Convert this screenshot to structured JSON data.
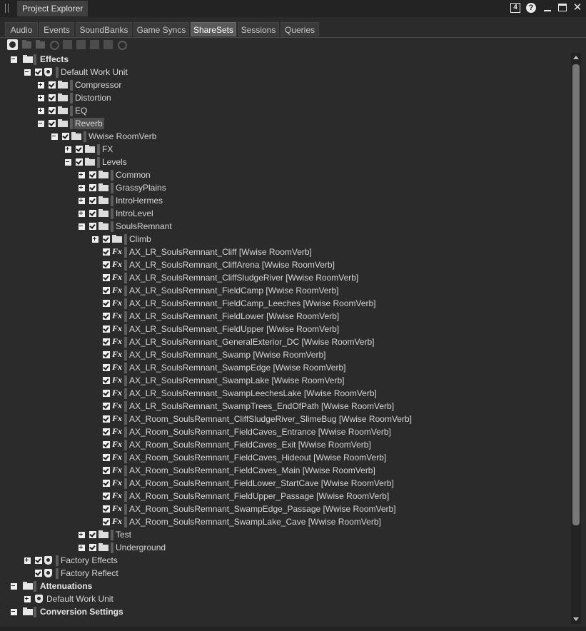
{
  "titlebar": {
    "title": "Project Explorer",
    "badge": "4",
    "help_glyph": "?",
    "close_glyph": "✕"
  },
  "tabs": [
    {
      "label": "Audio",
      "active": false
    },
    {
      "label": "Events",
      "active": false
    },
    {
      "label": "SoundBanks",
      "active": false
    },
    {
      "label": "Game Syncs",
      "active": false
    },
    {
      "label": "ShareSets",
      "active": true
    },
    {
      "label": "Sessions",
      "active": false
    },
    {
      "label": "Queries",
      "active": false
    }
  ],
  "toolbar": {
    "icons": [
      "workunit-filter-icon",
      "folder-filter-icon",
      "folder-open-filter-icon",
      "effect-filter-icon",
      "switch-filter-icon",
      "waveform-filter-icon",
      "curve-filter-icon",
      "meter-filter-icon",
      "clock-filter-icon"
    ]
  },
  "tree": [
    {
      "label": "Effects",
      "level": 0,
      "icon": "folder",
      "expander": "minus",
      "check": false,
      "bold": true
    },
    {
      "label": "Default Work Unit",
      "level": 1,
      "icon": "workunit",
      "expander": "minus",
      "check": true
    },
    {
      "label": "Compressor",
      "level": 2,
      "icon": "folder",
      "expander": "plus",
      "check": true
    },
    {
      "label": "Distortion",
      "level": 2,
      "icon": "folder",
      "expander": "plus",
      "check": true
    },
    {
      "label": "EQ",
      "level": 2,
      "icon": "folder",
      "expander": "plus",
      "check": true
    },
    {
      "label": "Reverb",
      "level": 2,
      "icon": "folder",
      "expander": "minus",
      "check": true,
      "selected": true
    },
    {
      "label": "Wwise RoomVerb",
      "level": 3,
      "icon": "folder",
      "expander": "minus",
      "check": true
    },
    {
      "label": "FX",
      "level": 4,
      "icon": "folder",
      "expander": "plus",
      "check": true
    },
    {
      "label": "Levels",
      "level": 4,
      "icon": "folder",
      "expander": "minus",
      "check": true
    },
    {
      "label": "Common",
      "level": 5,
      "icon": "folder",
      "expander": "plus",
      "check": true
    },
    {
      "label": "GrassyPlains",
      "level": 5,
      "icon": "folder",
      "expander": "plus",
      "check": true
    },
    {
      "label": "IntroHermes",
      "level": 5,
      "icon": "folder",
      "expander": "plus",
      "check": true
    },
    {
      "label": "IntroLevel",
      "level": 5,
      "icon": "folder",
      "expander": "plus",
      "check": true
    },
    {
      "label": "SoulsRemnant",
      "level": 5,
      "icon": "folder",
      "expander": "minus",
      "check": true
    },
    {
      "label": "Climb",
      "level": 6,
      "icon": "folder",
      "expander": "plus",
      "check": true
    },
    {
      "label": "AX_LR_SoulsRemnant_Cliff [Wwise RoomVerb]",
      "level": 6,
      "icon": "fx",
      "check": true
    },
    {
      "label": "AX_LR_SoulsRemnant_CliffArena [Wwise RoomVerb]",
      "level": 6,
      "icon": "fx",
      "check": true
    },
    {
      "label": "AX_LR_SoulsRemnant_CliffSludgeRiver [Wwise RoomVerb]",
      "level": 6,
      "icon": "fx",
      "check": true
    },
    {
      "label": "AX_LR_SoulsRemnant_FieldCamp [Wwise RoomVerb]",
      "level": 6,
      "icon": "fx",
      "check": true
    },
    {
      "label": "AX_LR_SoulsRemnant_FieldCamp_Leeches [Wwise RoomVerb]",
      "level": 6,
      "icon": "fx",
      "check": true
    },
    {
      "label": "AX_LR_SoulsRemnant_FieldLower [Wwise RoomVerb]",
      "level": 6,
      "icon": "fx",
      "check": true
    },
    {
      "label": "AX_LR_SoulsRemnant_FieldUpper [Wwise RoomVerb]",
      "level": 6,
      "icon": "fx",
      "check": true
    },
    {
      "label": "AX_LR_SoulsRemnant_GeneralExterior_DC [Wwise RoomVerb]",
      "level": 6,
      "icon": "fx",
      "check": true
    },
    {
      "label": "AX_LR_SoulsRemnant_Swamp [Wwise RoomVerb]",
      "level": 6,
      "icon": "fx",
      "check": true
    },
    {
      "label": "AX_LR_SoulsRemnant_SwampEdge [Wwise RoomVerb]",
      "level": 6,
      "icon": "fx",
      "check": true
    },
    {
      "label": "AX_LR_SoulsRemnant_SwampLake [Wwise RoomVerb]",
      "level": 6,
      "icon": "fx",
      "check": true
    },
    {
      "label": "AX_LR_SoulsRemnant_SwampLeechesLake [Wwise RoomVerb]",
      "level": 6,
      "icon": "fx",
      "check": true
    },
    {
      "label": "AX_LR_SoulsRemnant_SwampTrees_EndOfPath [Wwise RoomVerb]",
      "level": 6,
      "icon": "fx",
      "check": true
    },
    {
      "label": "AX_Room_SoulsRemnant_CliffSludgeRiver_SlimeBug [Wwise RoomVerb]",
      "level": 6,
      "icon": "fx",
      "check": true
    },
    {
      "label": "AX_Room_SoulsRemnant_FieldCaves_Entrance [Wwise RoomVerb]",
      "level": 6,
      "icon": "fx",
      "check": true
    },
    {
      "label": "AX_Room_SoulsRemnant_FieldCaves_Exit [Wwise RoomVerb]",
      "level": 6,
      "icon": "fx",
      "check": true
    },
    {
      "label": "AX_Room_SoulsRemnant_FieldCaves_Hideout [Wwise RoomVerb]",
      "level": 6,
      "icon": "fx",
      "check": true
    },
    {
      "label": "AX_Room_SoulsRemnant_FieldCaves_Main [Wwise RoomVerb]",
      "level": 6,
      "icon": "fx",
      "check": true
    },
    {
      "label": "AX_Room_SoulsRemnant_FieldLower_StartCave [Wwise RoomVerb]",
      "level": 6,
      "icon": "fx",
      "check": true
    },
    {
      "label": "AX_Room_SoulsRemnant_FieldUpper_Passage [Wwise RoomVerb]",
      "level": 6,
      "icon": "fx",
      "check": true
    },
    {
      "label": "AX_Room_SoulsRemnant_SwampEdge_Passage [Wwise RoomVerb]",
      "level": 6,
      "icon": "fx",
      "check": true
    },
    {
      "label": "AX_Room_SoulsRemnant_SwampLake_Cave [Wwise RoomVerb]",
      "level": 6,
      "icon": "fx",
      "check": true
    },
    {
      "label": "Test",
      "level": 5,
      "icon": "folder",
      "expander": "plus",
      "check": true
    },
    {
      "label": "Underground",
      "level": 5,
      "icon": "folder",
      "expander": "plus",
      "check": true
    },
    {
      "label": "Factory Effects",
      "level": 1,
      "icon": "workunit",
      "expander": "plus",
      "check": true
    },
    {
      "label": "Factory Reflect",
      "level": 1,
      "icon": "workunit",
      "expander": "none",
      "check": true
    },
    {
      "label": "Attenuations",
      "level": 0,
      "icon": "folder",
      "expander": "minus",
      "check": false,
      "bold": true
    },
    {
      "label": "Default Work Unit",
      "level": 1,
      "icon": "workunit",
      "expander": "plus",
      "check": false,
      "noBar": true
    },
    {
      "label": "Conversion Settings",
      "level": 0,
      "icon": "folder",
      "expander": "minus",
      "check": false,
      "bold": true
    }
  ]
}
